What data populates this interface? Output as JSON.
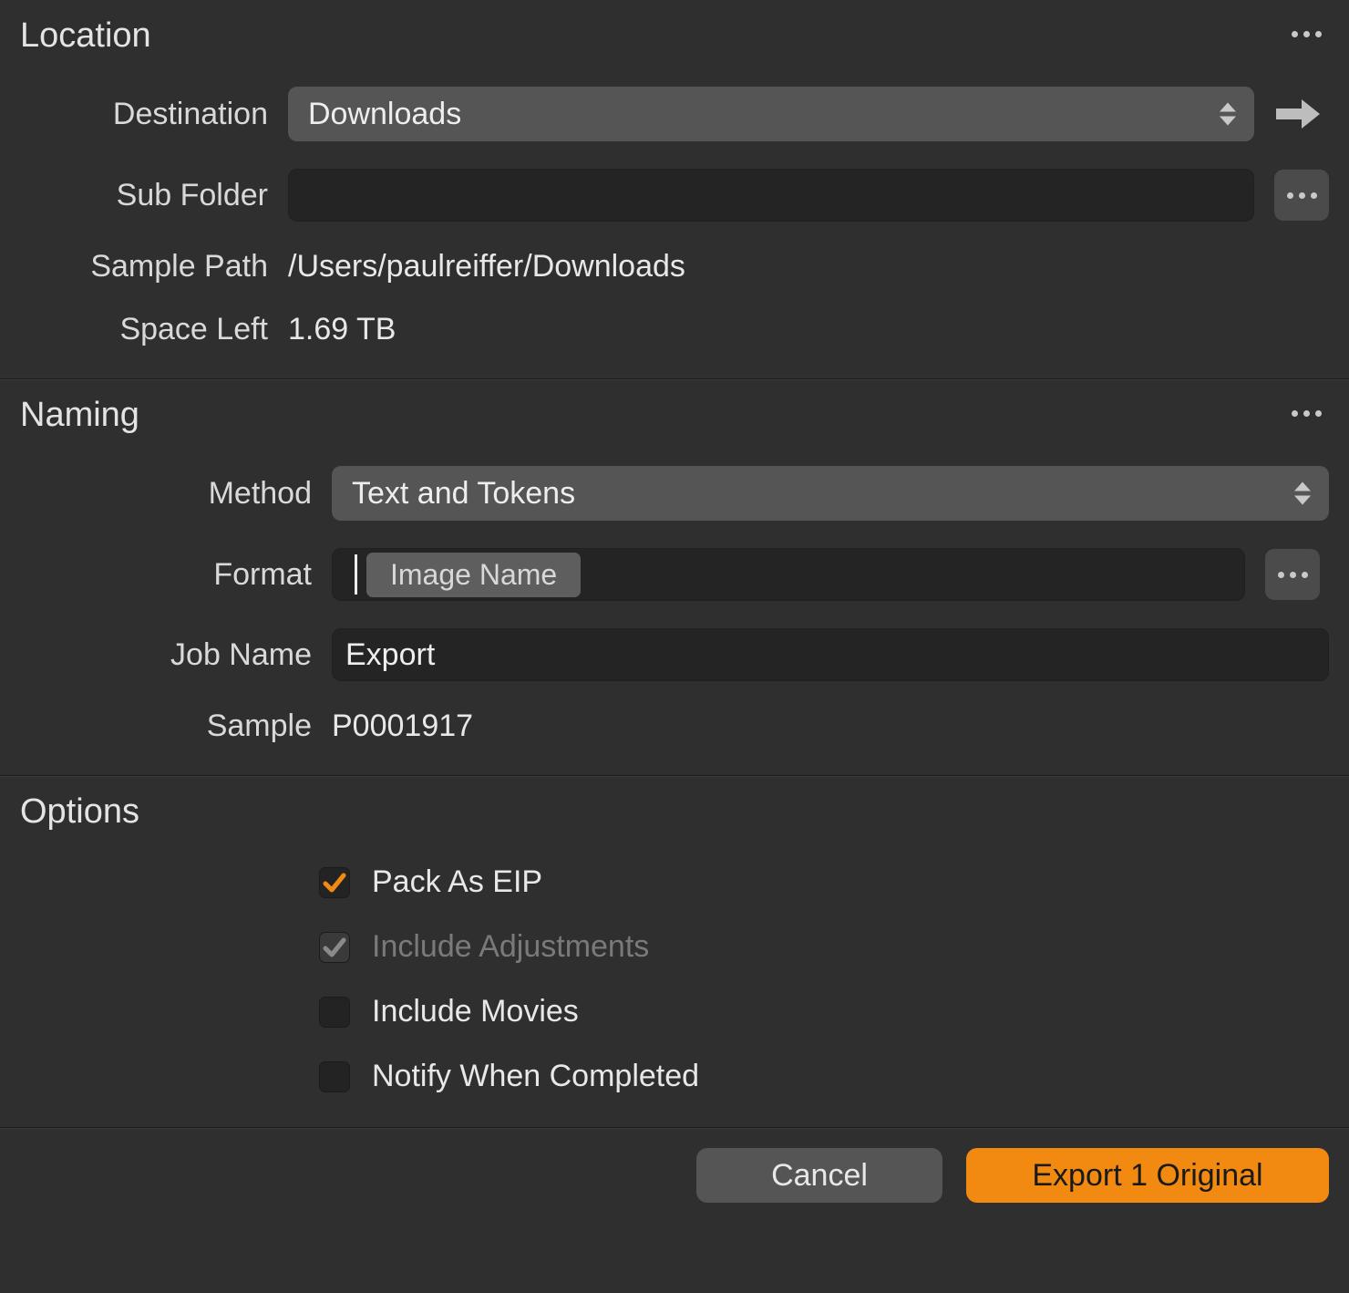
{
  "location": {
    "title": "Location",
    "destination_label": "Destination",
    "destination_value": "Downloads",
    "subfolder_label": "Sub Folder",
    "subfolder_value": "",
    "samplepath_label": "Sample Path",
    "samplepath_value": "/Users/paulreiffer/Downloads",
    "spaceleft_label": "Space Left",
    "spaceleft_value": "1.69 TB"
  },
  "naming": {
    "title": "Naming",
    "method_label": "Method",
    "method_value": "Text and Tokens",
    "format_label": "Format",
    "format_token": "Image Name",
    "jobname_label": "Job Name",
    "jobname_value": "Export",
    "sample_label": "Sample",
    "sample_value": "P0001917"
  },
  "options": {
    "title": "Options",
    "items": [
      {
        "label": "Pack As EIP",
        "checked": true,
        "disabled": false
      },
      {
        "label": "Include Adjustments",
        "checked": true,
        "disabled": true
      },
      {
        "label": "Include Movies",
        "checked": false,
        "disabled": false
      },
      {
        "label": "Notify When Completed",
        "checked": false,
        "disabled": false
      }
    ]
  },
  "footer": {
    "cancel": "Cancel",
    "export": "Export 1 Original"
  }
}
